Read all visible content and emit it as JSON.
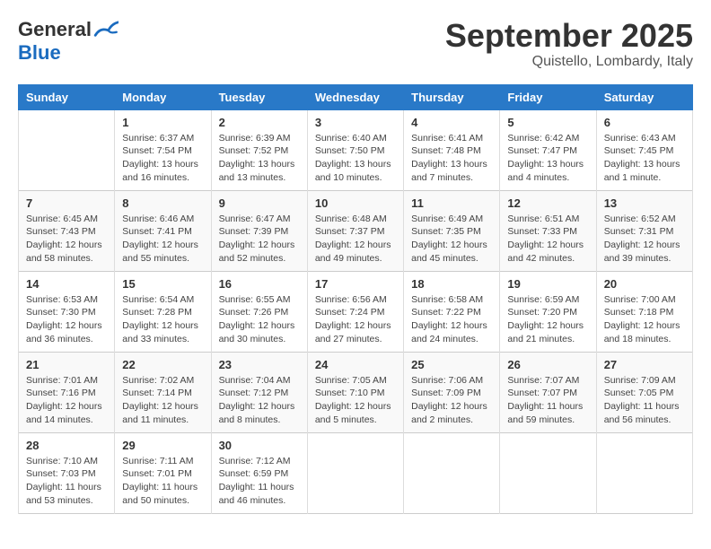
{
  "logo": {
    "general": "General",
    "blue": "Blue"
  },
  "title": {
    "month": "September 2025",
    "location": "Quistello, Lombardy, Italy"
  },
  "days_of_week": [
    "Sunday",
    "Monday",
    "Tuesday",
    "Wednesday",
    "Thursday",
    "Friday",
    "Saturday"
  ],
  "weeks": [
    [
      {
        "day": "",
        "info": ""
      },
      {
        "day": "1",
        "info": "Sunrise: 6:37 AM\nSunset: 7:54 PM\nDaylight: 13 hours\nand 16 minutes."
      },
      {
        "day": "2",
        "info": "Sunrise: 6:39 AM\nSunset: 7:52 PM\nDaylight: 13 hours\nand 13 minutes."
      },
      {
        "day": "3",
        "info": "Sunrise: 6:40 AM\nSunset: 7:50 PM\nDaylight: 13 hours\nand 10 minutes."
      },
      {
        "day": "4",
        "info": "Sunrise: 6:41 AM\nSunset: 7:48 PM\nDaylight: 13 hours\nand 7 minutes."
      },
      {
        "day": "5",
        "info": "Sunrise: 6:42 AM\nSunset: 7:47 PM\nDaylight: 13 hours\nand 4 minutes."
      },
      {
        "day": "6",
        "info": "Sunrise: 6:43 AM\nSunset: 7:45 PM\nDaylight: 13 hours\nand 1 minute."
      }
    ],
    [
      {
        "day": "7",
        "info": "Sunrise: 6:45 AM\nSunset: 7:43 PM\nDaylight: 12 hours\nand 58 minutes."
      },
      {
        "day": "8",
        "info": "Sunrise: 6:46 AM\nSunset: 7:41 PM\nDaylight: 12 hours\nand 55 minutes."
      },
      {
        "day": "9",
        "info": "Sunrise: 6:47 AM\nSunset: 7:39 PM\nDaylight: 12 hours\nand 52 minutes."
      },
      {
        "day": "10",
        "info": "Sunrise: 6:48 AM\nSunset: 7:37 PM\nDaylight: 12 hours\nand 49 minutes."
      },
      {
        "day": "11",
        "info": "Sunrise: 6:49 AM\nSunset: 7:35 PM\nDaylight: 12 hours\nand 45 minutes."
      },
      {
        "day": "12",
        "info": "Sunrise: 6:51 AM\nSunset: 7:33 PM\nDaylight: 12 hours\nand 42 minutes."
      },
      {
        "day": "13",
        "info": "Sunrise: 6:52 AM\nSunset: 7:31 PM\nDaylight: 12 hours\nand 39 minutes."
      }
    ],
    [
      {
        "day": "14",
        "info": "Sunrise: 6:53 AM\nSunset: 7:30 PM\nDaylight: 12 hours\nand 36 minutes."
      },
      {
        "day": "15",
        "info": "Sunrise: 6:54 AM\nSunset: 7:28 PM\nDaylight: 12 hours\nand 33 minutes."
      },
      {
        "day": "16",
        "info": "Sunrise: 6:55 AM\nSunset: 7:26 PM\nDaylight: 12 hours\nand 30 minutes."
      },
      {
        "day": "17",
        "info": "Sunrise: 6:56 AM\nSunset: 7:24 PM\nDaylight: 12 hours\nand 27 minutes."
      },
      {
        "day": "18",
        "info": "Sunrise: 6:58 AM\nSunset: 7:22 PM\nDaylight: 12 hours\nand 24 minutes."
      },
      {
        "day": "19",
        "info": "Sunrise: 6:59 AM\nSunset: 7:20 PM\nDaylight: 12 hours\nand 21 minutes."
      },
      {
        "day": "20",
        "info": "Sunrise: 7:00 AM\nSunset: 7:18 PM\nDaylight: 12 hours\nand 18 minutes."
      }
    ],
    [
      {
        "day": "21",
        "info": "Sunrise: 7:01 AM\nSunset: 7:16 PM\nDaylight: 12 hours\nand 14 minutes."
      },
      {
        "day": "22",
        "info": "Sunrise: 7:02 AM\nSunset: 7:14 PM\nDaylight: 12 hours\nand 11 minutes."
      },
      {
        "day": "23",
        "info": "Sunrise: 7:04 AM\nSunset: 7:12 PM\nDaylight: 12 hours\nand 8 minutes."
      },
      {
        "day": "24",
        "info": "Sunrise: 7:05 AM\nSunset: 7:10 PM\nDaylight: 12 hours\nand 5 minutes."
      },
      {
        "day": "25",
        "info": "Sunrise: 7:06 AM\nSunset: 7:09 PM\nDaylight: 12 hours\nand 2 minutes."
      },
      {
        "day": "26",
        "info": "Sunrise: 7:07 AM\nSunset: 7:07 PM\nDaylight: 11 hours\nand 59 minutes."
      },
      {
        "day": "27",
        "info": "Sunrise: 7:09 AM\nSunset: 7:05 PM\nDaylight: 11 hours\nand 56 minutes."
      }
    ],
    [
      {
        "day": "28",
        "info": "Sunrise: 7:10 AM\nSunset: 7:03 PM\nDaylight: 11 hours\nand 53 minutes."
      },
      {
        "day": "29",
        "info": "Sunrise: 7:11 AM\nSunset: 7:01 PM\nDaylight: 11 hours\nand 50 minutes."
      },
      {
        "day": "30",
        "info": "Sunrise: 7:12 AM\nSunset: 6:59 PM\nDaylight: 11 hours\nand 46 minutes."
      },
      {
        "day": "",
        "info": ""
      },
      {
        "day": "",
        "info": ""
      },
      {
        "day": "",
        "info": ""
      },
      {
        "day": "",
        "info": ""
      }
    ]
  ]
}
